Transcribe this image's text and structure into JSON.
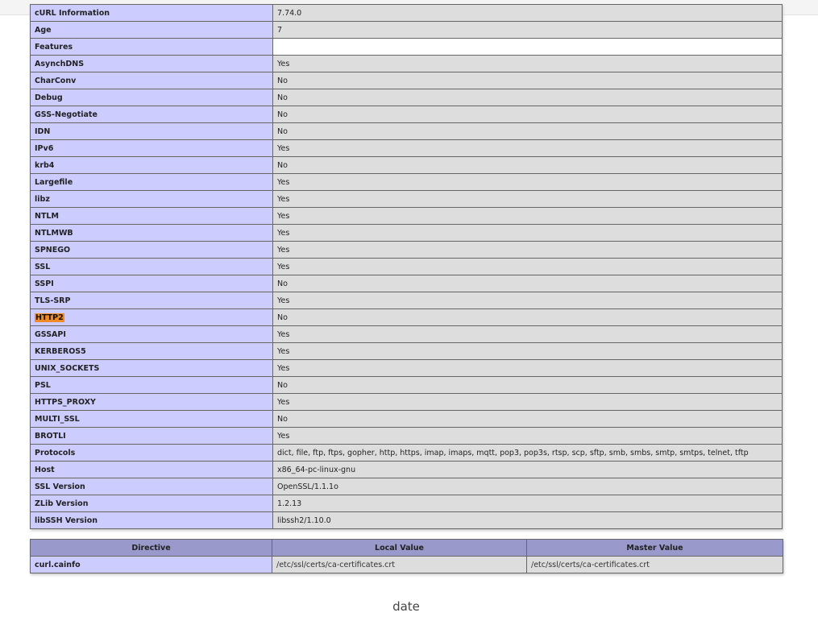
{
  "curl_table": {
    "clipped_row": {
      "label": "cURL Information",
      "value": "7.74.0"
    },
    "rows": [
      {
        "label": "Age",
        "value": "7"
      },
      {
        "label": "Features",
        "value": ""
      },
      {
        "label": "AsynchDNS",
        "value": "Yes"
      },
      {
        "label": "CharConv",
        "value": "No"
      },
      {
        "label": "Debug",
        "value": "No"
      },
      {
        "label": "GSS-Negotiate",
        "value": "No"
      },
      {
        "label": "IDN",
        "value": "No"
      },
      {
        "label": "IPv6",
        "value": "Yes"
      },
      {
        "label": "krb4",
        "value": "No"
      },
      {
        "label": "Largefile",
        "value": "Yes"
      },
      {
        "label": "libz",
        "value": "Yes"
      },
      {
        "label": "NTLM",
        "value": "Yes"
      },
      {
        "label": "NTLMWB",
        "value": "Yes"
      },
      {
        "label": "SPNEGO",
        "value": "Yes"
      },
      {
        "label": "SSL",
        "value": "Yes"
      },
      {
        "label": "SSPI",
        "value": "No"
      },
      {
        "label": "TLS-SRP",
        "value": "Yes"
      },
      {
        "label": "HTTP2",
        "value": "No"
      },
      {
        "label": "GSSAPI",
        "value": "Yes"
      },
      {
        "label": "KERBEROS5",
        "value": "Yes"
      },
      {
        "label": "UNIX_SOCKETS",
        "value": "Yes"
      },
      {
        "label": "PSL",
        "value": "No"
      },
      {
        "label": "HTTPS_PROXY",
        "value": "Yes"
      },
      {
        "label": "MULTI_SSL",
        "value": "No"
      },
      {
        "label": "BROTLI",
        "value": "Yes"
      },
      {
        "label": "Protocols",
        "value": "dict, file, ftp, ftps, gopher, http, https, imap, imaps, mqtt, pop3, pop3s, rtsp, scp, sftp, smb, smbs, smtp, smtps, telnet, tftp"
      },
      {
        "label": "Host",
        "value": "x86_64-pc-linux-gnu"
      },
      {
        "label": "SSL Version",
        "value": "OpenSSL/1.1.1o"
      },
      {
        "label": "ZLib Version",
        "value": "1.2.13"
      },
      {
        "label": "libSSH Version",
        "value": "libssh2/1.10.0"
      }
    ]
  },
  "directives_table": {
    "headers": [
      "Directive",
      "Local Value",
      "Master Value"
    ],
    "rows": [
      {
        "directive": "curl.cainfo",
        "local": "/etc/ssl/certs/ca-certificates.crt",
        "master": "/etc/ssl/certs/ca-certificates.crt"
      }
    ]
  },
  "find_highlight": {
    "term": "HTTP2",
    "color": "#f08a24"
  },
  "footer": {
    "section_title": "date"
  },
  "colors": {
    "label_cell": "#ccccff",
    "value_cell": "#dddddd",
    "header_cell": "#9999cc"
  }
}
